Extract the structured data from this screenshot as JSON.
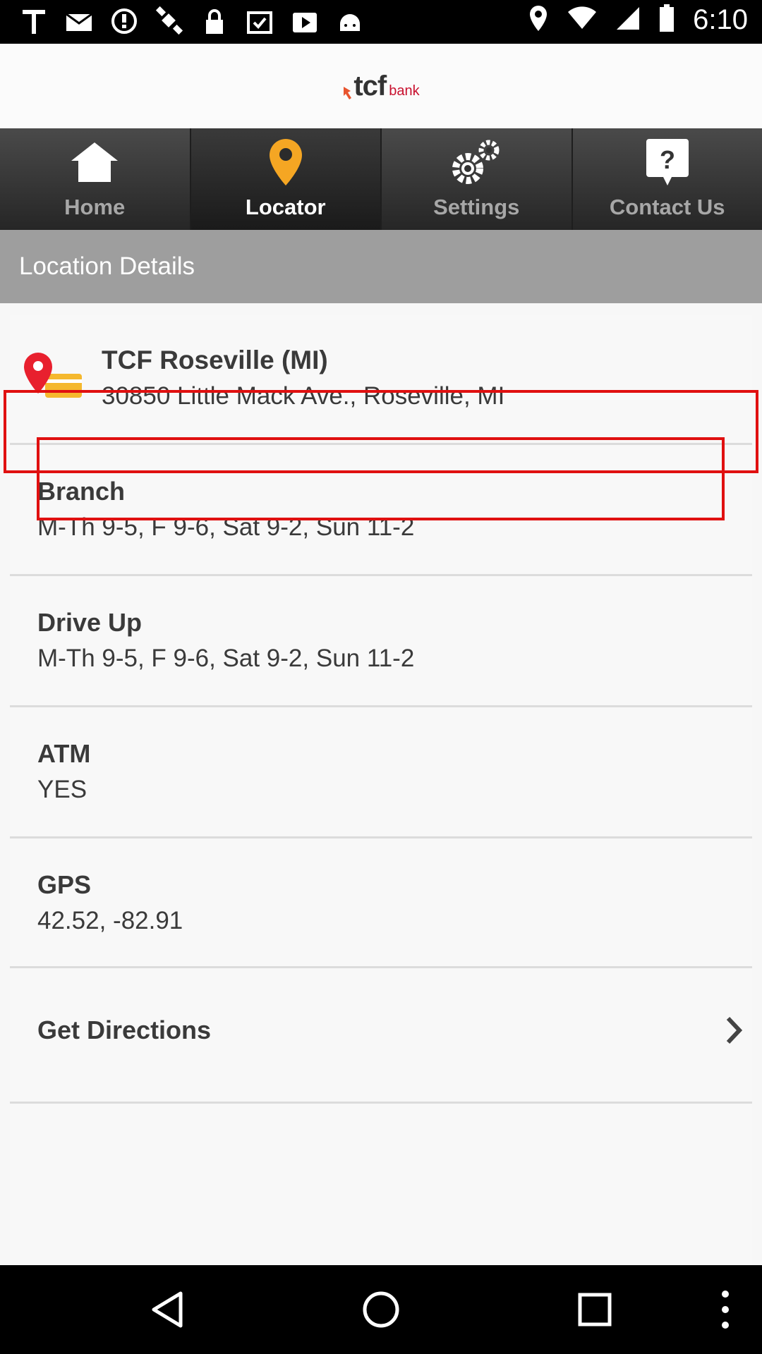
{
  "status_bar": {
    "time": "6:10",
    "icons": [
      "text-icon",
      "gmail-icon",
      "alert-icon",
      "satellite-icon",
      "lock-icon",
      "clipboard-icon",
      "play-icon",
      "android-icon"
    ]
  },
  "header": {
    "logo_text": "tcf",
    "logo_suffix": "bank"
  },
  "tabs": [
    {
      "label": "Home",
      "icon": "home-icon",
      "active": false
    },
    {
      "label": "Locator",
      "icon": "pin-icon",
      "active": true
    },
    {
      "label": "Settings",
      "icon": "gear-icon",
      "active": false
    },
    {
      "label": "Contact Us",
      "icon": "question-icon",
      "active": false
    }
  ],
  "section_title": "Location Details",
  "location": {
    "name": "TCF Roseville (MI)",
    "address": "30850 Little Mack Ave., Roseville, MI"
  },
  "details": [
    {
      "title": "Branch",
      "value": "M-Th 9-5, F 9-6, Sat 9-2, Sun 11-2"
    },
    {
      "title": "Drive Up",
      "value": "M-Th 9-5, F 9-6, Sat 9-2, Sun 11-2"
    },
    {
      "title": "ATM",
      "value": "YES"
    },
    {
      "title": "GPS",
      "value": "42.52, -82.91"
    }
  ],
  "directions_label": "Get Directions",
  "colors": {
    "accent": "#f5a623",
    "brand_red": "#c8102e",
    "highlight": "#e01010"
  }
}
